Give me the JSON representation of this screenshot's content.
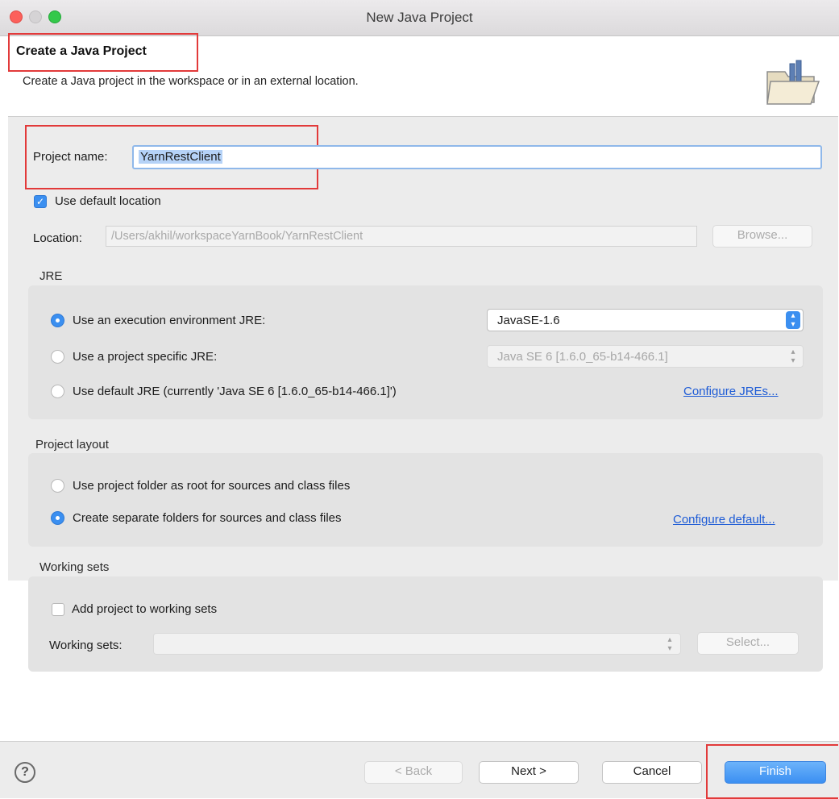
{
  "window": {
    "title": "New Java Project",
    "traffic_lights": {
      "close": "#fc605b",
      "minimize": "#fdbc40",
      "zoom": "#34c84a"
    }
  },
  "header": {
    "title": "Create a Java Project",
    "description": "Create a Java project in the workspace or in an external location."
  },
  "project": {
    "name_label": "Project name:",
    "name_value": "YarnRestClient",
    "use_default_location_label": "Use default location",
    "use_default_location_checked": true,
    "location_label": "Location:",
    "location_value": "/Users/akhil/workspaceYarnBook/YarnRestClient",
    "browse_label": "Browse..."
  },
  "jre": {
    "title": "JRE",
    "options": [
      {
        "label": "Use an execution environment JRE:",
        "selected": true
      },
      {
        "label": "Use a project specific JRE:",
        "selected": false
      },
      {
        "label": "Use default JRE (currently 'Java SE 6 [1.6.0_65-b14-466.1]')",
        "selected": false
      }
    ],
    "execution_env_value": "JavaSE-1.6",
    "project_specific_value": "Java SE 6 [1.6.0_65-b14-466.1]",
    "configure_link": "Configure JREs..."
  },
  "layout": {
    "title": "Project layout",
    "options": [
      {
        "label": "Use project folder as root for sources and class files",
        "selected": false
      },
      {
        "label": "Create separate folders for sources and class files",
        "selected": true
      }
    ],
    "configure_link": "Configure default..."
  },
  "working_sets": {
    "title": "Working sets",
    "add_label": "Add project to working sets",
    "add_checked": false,
    "sets_label": "Working sets:",
    "sets_value": "",
    "select_label": "Select..."
  },
  "footer": {
    "help_icon": "?",
    "back_label": "< Back",
    "next_label": "Next >",
    "cancel_label": "Cancel",
    "finish_label": "Finish"
  },
  "colors": {
    "accent": "#3b8ff0",
    "highlight_box": "#e23a3a",
    "link": "#1d5bd6"
  }
}
